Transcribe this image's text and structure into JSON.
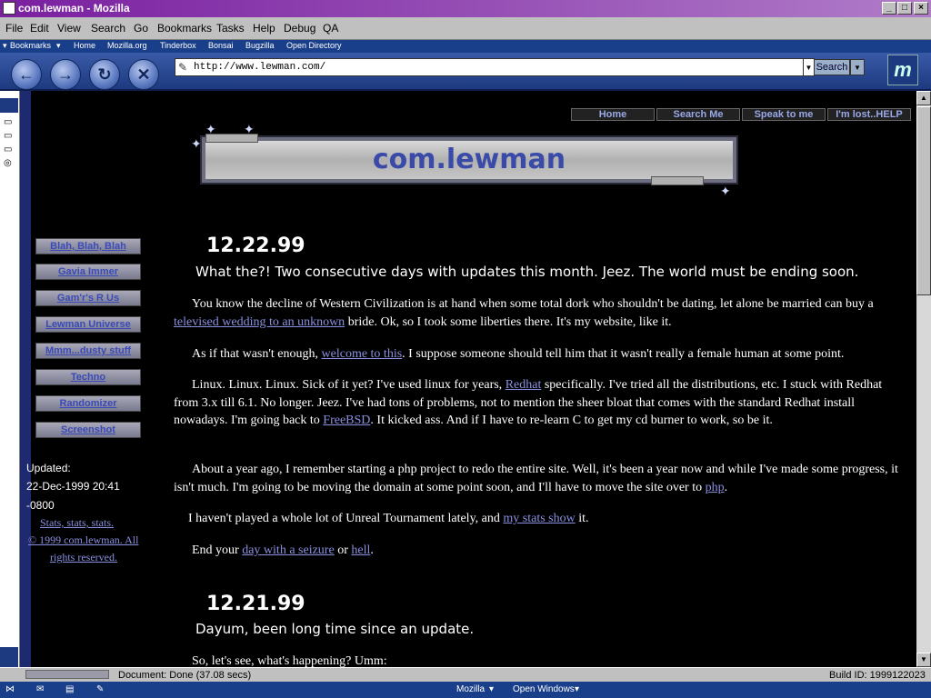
{
  "window": {
    "title": "com.lewman - Mozilla"
  },
  "menubar": {
    "items": [
      "File",
      "Edit",
      "View",
      "Search",
      "Go",
      "Bookmarks",
      "Tasks",
      "Help",
      "Debug",
      "QA"
    ]
  },
  "personal_toolbar": {
    "items": [
      "Bookmarks",
      "Home",
      "Mozilla.org",
      "Tinderbox",
      "Bonsai",
      "Bugzilla",
      "Open Directory"
    ]
  },
  "navbar": {
    "url": "http://www.lewman.com/",
    "search_label": "Search",
    "back_glyph": "←",
    "forward_glyph": "→",
    "reload_glyph": "↻",
    "stop_glyph": "✕",
    "throbber_glyph": "m"
  },
  "page": {
    "top_nav": [
      "Home",
      "Search Me",
      "Speak to me",
      "I'm lost..HELP"
    ],
    "banner_title": "com.lewman",
    "left_nav": [
      "Blah, Blah, Blah",
      "Gavia Immer",
      "Gam'r's R Us",
      "Lewman Universe",
      "Mmm...dusty stuff",
      "Techno",
      "Randomizer",
      "Screenshot"
    ],
    "updated_label": "Updated:",
    "updated_date": "22-Dec-1999 20:41",
    "updated_tz": "-0800",
    "stats_link": "Stats, stats, stats.",
    "copyright_line1": "© 1999 com.lewman.  All",
    "copyright_line2": "rights reserved.",
    "entries": [
      {
        "date": "12.22.99",
        "subtitle": "What the?!  Two consecutive days with updates this month.  Jeez.  The world must be ending soon.",
        "p1_a": "You know the decline of Western Civilization is at hand when some total dork who shouldn't be dating, let alone be married can buy a ",
        "p1_link": "televised wedding to an unknown",
        "p1_b": " bride.  Ok, so I took some liberties there.  It's my website, like it.",
        "p2_a": "As if that wasn't enough, ",
        "p2_link": "welcome to this",
        "p2_b": ".  I suppose someone should tell him that it wasn't really a female human at some point.",
        "p3_a": "Linux. Linux. Linux.  Sick of it yet?  I've used linux for years, ",
        "p3_link1": "Redhat",
        "p3_b": " specifically.  I've tried all the distributions, etc.  I stuck with Redhat from 3.x till 6.1.  No longer.  Jeez.  I've had tons of problems, not to mention the sheer bloat that comes with the standard Redhat install nowadays. I'm going back to ",
        "p3_link2": "FreeBSD",
        "p3_c": ".  It kicked ass.  And if I have to re-learn C to get my cd burner to work, so be it.",
        "p4_a": "About a year ago, I remember starting a php project to redo the entire site.  Well, it's been a year now and while I've made some progress, it isn't much.  I'm going to be moving the domain at some point soon, and I'll have to move the site over to ",
        "p4_link": "php",
        "p4_b": ".",
        "p5_a": "I haven't played a whole lot of Unreal Tournament lately, and ",
        "p5_link": "my stats show",
        "p5_b": " it.",
        "p6_a": "End your ",
        "p6_link1": "day with a seizure",
        "p6_b": " or ",
        "p6_link2": "hell",
        "p6_c": "."
      },
      {
        "date": "12.21.99",
        "subtitle": "Dayum, been long time since an update.",
        "p1": "So, let's see, what's happening?   Umm:"
      }
    ]
  },
  "statusbar": {
    "text": "Document: Done (37.08 secs)",
    "build": "Build ID: 1999122023"
  },
  "taskbar": {
    "app": "Mozilla",
    "open_windows": "Open Windows"
  },
  "colors": {
    "content_bg": "#000000",
    "link": "#8a90e0",
    "toolbar": "#1d3a80",
    "title_bar": "#7a1fa0"
  }
}
